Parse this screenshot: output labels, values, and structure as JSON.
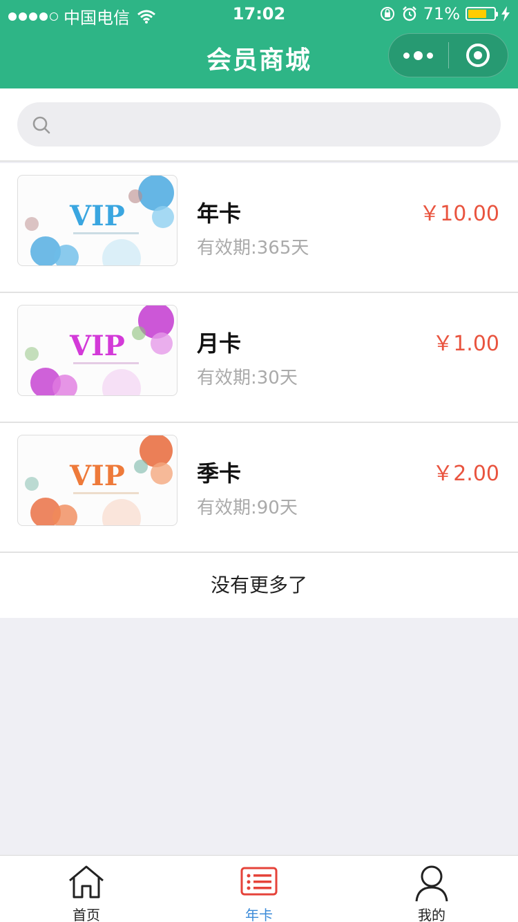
{
  "status_bar": {
    "carrier": "中国电信",
    "time": "17:02",
    "battery": "71%",
    "battery_level": 0.71
  },
  "nav": {
    "title": "会员商城"
  },
  "search": {
    "placeholder": ""
  },
  "cards": [
    {
      "name": "年卡",
      "validity": "有效期:365天",
      "price": "￥10.00",
      "card_text": "VIP",
      "accent": "#3aa6e0"
    },
    {
      "name": "月卡",
      "validity": "有效期:30天",
      "price": "￥1.00",
      "card_text": "VIP",
      "accent": "#d33ad8"
    },
    {
      "name": "季卡",
      "validity": "有效期:90天",
      "price": "￥2.00",
      "card_text": "VIP",
      "accent": "#ee7a3a"
    }
  ],
  "footer_note": "没有更多了",
  "tabbar": {
    "items": [
      {
        "label": "首页",
        "icon": "home-icon",
        "active": false
      },
      {
        "label": "年卡",
        "icon": "card-list-icon",
        "active": true
      },
      {
        "label": "我的",
        "icon": "user-icon",
        "active": false
      }
    ]
  },
  "colors": {
    "brand": "#2eb586",
    "price": "#e9543f",
    "active_tab": "#3a8ad8",
    "active_icon": "#e5433a"
  }
}
